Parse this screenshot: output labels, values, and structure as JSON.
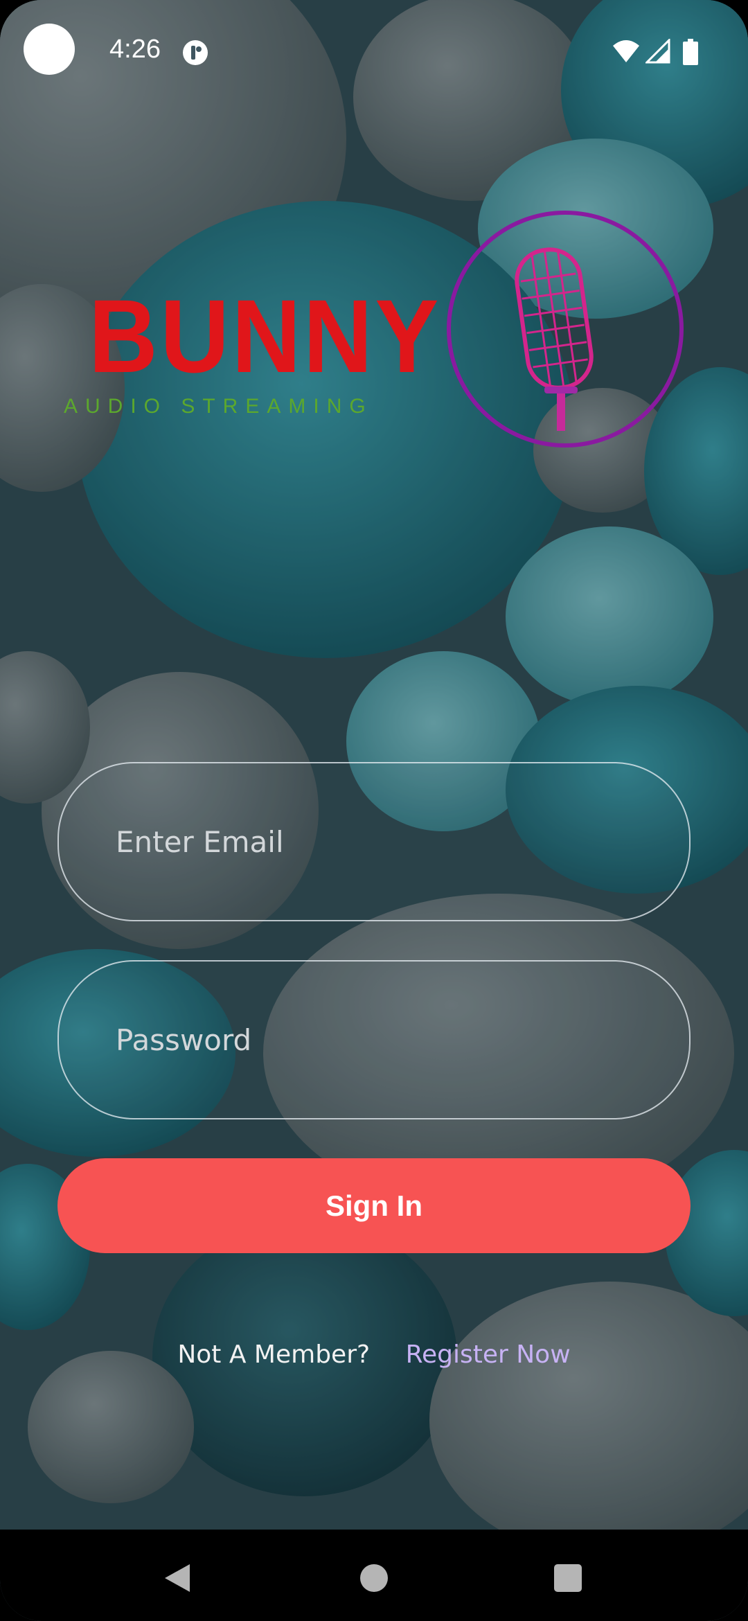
{
  "status_bar": {
    "time": "4:26"
  },
  "logo": {
    "brand_name": "BUNNY",
    "tagline": "AUDIO STREAMING"
  },
  "form": {
    "email_placeholder": "Enter Email",
    "password_placeholder": "Password",
    "sign_in_label": "Sign In"
  },
  "register": {
    "prompt": "Not A Member?",
    "link_label": "Register Now"
  },
  "colors": {
    "brand_red": "#e0161a",
    "tagline_green": "#5ca82d",
    "button_coral": "#f75353",
    "link_lavender": "#c7b2f4",
    "mic_ring_purple": "#8a1aa0",
    "mic_magenta": "#d4258c"
  },
  "icons": {
    "status": [
      "camera-dot-icon",
      "notification-icon",
      "wifi-icon",
      "signal-icon",
      "battery-icon"
    ],
    "navigation": [
      "back-icon",
      "home-icon",
      "recents-icon"
    ],
    "logo": "microphone-icon"
  }
}
